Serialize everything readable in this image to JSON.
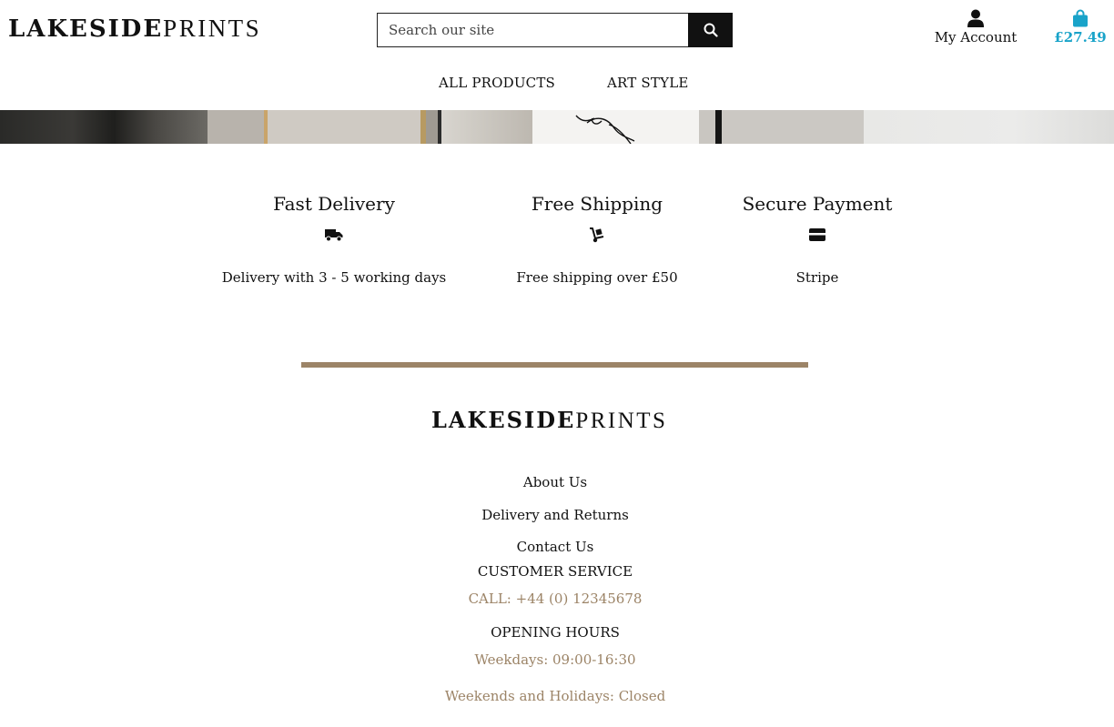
{
  "header": {
    "logo_bold": "LAKESIDE",
    "logo_thin": "PRINTS",
    "search_placeholder": "Search our site",
    "account_label": "My Account",
    "cart_total": "£27.49"
  },
  "nav": {
    "items": [
      {
        "label": "ALL PRODUCTS"
      },
      {
        "label": "ART STYLE"
      }
    ]
  },
  "features": [
    {
      "title": "Fast Delivery",
      "icon": "truck-icon",
      "desc": "Delivery with 3 - 5 working days"
    },
    {
      "title": "Free Shipping",
      "icon": "dolly-icon",
      "desc": "Free shipping over £50"
    },
    {
      "title": "Secure Payment",
      "icon": "credit-card-icon",
      "desc": "Stripe"
    }
  ],
  "footer": {
    "logo_bold": "LAKESIDE",
    "logo_thin": "PRINTS",
    "links": [
      {
        "label": "About Us"
      },
      {
        "label": "Delivery and Returns"
      },
      {
        "label": "Contact Us"
      }
    ],
    "customer_service_heading": "CUSTOMER SERVICE",
    "phone": "CALL: +44 (0) 12345678",
    "opening_hours_heading": "OPENING HOURS",
    "weekdays": "Weekdays: 09:00-16:30",
    "weekends": "Weekends and Holidays: Closed"
  },
  "colors": {
    "accent": "#9c8467",
    "cart": "#19a3c9",
    "text": "#111111"
  }
}
